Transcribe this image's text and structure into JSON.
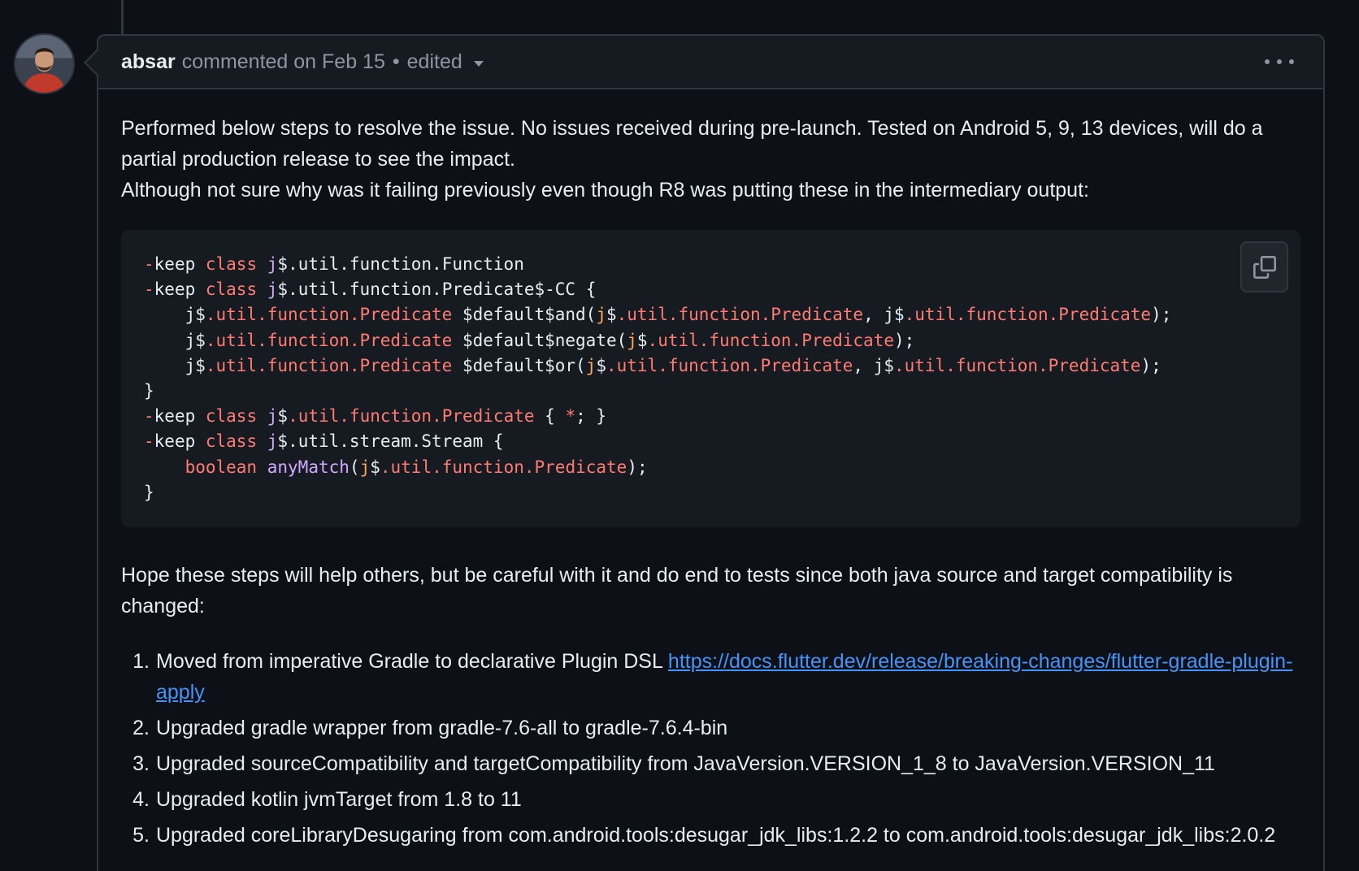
{
  "comment": {
    "author": "absar",
    "meta": "commented on Feb 15",
    "separator": "•",
    "edited_label": "edited",
    "intro_line1": "Performed below steps to resolve the issue. No issues received during pre-launch. Tested on Android 5, 9, 13 devices, will do a partial production release to see the impact.",
    "intro_line2": "Although not sure why was it failing previously even though R8 was putting these in the intermediary output:",
    "code_lines": [
      "-keep class j$.util.function.Function",
      "-keep class j$.util.function.Predicate$-CC {",
      "    j$.util.function.Predicate $default$and(j$.util.function.Predicate, j$.util.function.Predicate);",
      "    j$.util.function.Predicate $default$negate(j$.util.function.Predicate);",
      "    j$.util.function.Predicate $default$or(j$.util.function.Predicate, j$.util.function.Predicate);",
      "}",
      "-keep class j$.util.function.Predicate { *; }",
      "-keep class j$.util.stream.Stream {",
      "    boolean anyMatch(j$.util.function.Predicate);",
      "}"
    ],
    "outro": "Hope these steps will help others, but be careful with it and do end to tests since both java source and target compatibility is changed:",
    "steps": [
      {
        "num": "1.",
        "text": "Moved from imperative Gradle to declarative Plugin DSL ",
        "link": "https://docs.flutter.dev/release/breaking-changes/flutter-gradle-plugin-apply"
      },
      {
        "num": "2.",
        "text": "Upgraded gradle wrapper from gradle-7.6-all to gradle-7.6.4-bin"
      },
      {
        "num": "3.",
        "text": "Upgraded sourceCompatibility and targetCompatibility from JavaVersion.VERSION_1_8 to JavaVersion.VERSION_11"
      },
      {
        "num": "4.",
        "text": "Upgraded kotlin jvmTarget from 1.8 to 11"
      },
      {
        "num": "5.",
        "text": "Upgraded coreLibraryDesugaring from com.android.tools:desugar_jdk_libs:1.2.2 to com.android.tools:desugar_jdk_libs:2.0.2"
      }
    ]
  },
  "icons": {
    "copy": "copy-icon",
    "more": "kebab-horizontal-icon",
    "caret": "triangle-down-icon"
  },
  "colors": {
    "background": "#0d1117",
    "header_bg": "#161b22",
    "border": "#30363d",
    "text": "#e6edf3",
    "muted": "#8d96a0",
    "link": "#4493f8",
    "keyword": "#ff7b72",
    "entity": "#d2a8ff",
    "type": "#ffa657"
  }
}
